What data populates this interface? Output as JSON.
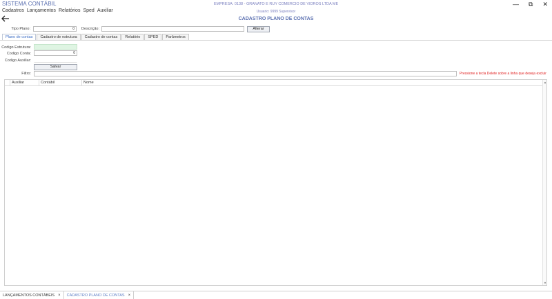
{
  "app": {
    "title": "SISTEMA CONTÁBIL",
    "company": "EMPRESA: 0138 - GRANATO E RUY COMERCIO DE VIDROS LTDA ME",
    "user": "Usuario: 9999 Supervisor",
    "screen_title": "CADASTRO PLANO DE CONTAS"
  },
  "menu": [
    "Cadastros",
    "Lançamentos",
    "Relatórios",
    "Sped",
    "Auxiliar"
  ],
  "window_controls": {
    "minimize": "—",
    "restore": "⧉",
    "close": "✕"
  },
  "form_top": {
    "tipo_plano_label": "Tipo Plano:",
    "tipo_plano_value": "0",
    "descricao_label": "Descrição:",
    "descricao_value": "",
    "alterar_label": "Alterar"
  },
  "tabs": [
    "Plano de contas",
    "Cadastro de estrutura",
    "Cadastro de contas",
    "Relatório",
    "SPED",
    "Parâmetros"
  ],
  "form": {
    "codigo_estrutura_label": "Codigo Estrutura:",
    "codigo_estrutura_value": "",
    "codigo_conta_label": "Codigo Conta:",
    "codigo_conta_value": "0",
    "codigo_auxiliar_label": "Codigo Auxiliar:",
    "codigo_auxiliar_value": "",
    "salvar_label": "Salvar",
    "filtro_label": "Filtro:",
    "filtro_value": "",
    "hint": "Pressione a tecla Delete sobre a linha que deseja excluir"
  },
  "grid": {
    "columns": [
      "Auxiliar",
      "Contábil",
      "Nome"
    ],
    "rows": []
  },
  "taskbar": [
    {
      "label": "LANÇAMENTOS CONTÁBEIS",
      "close": "×"
    },
    {
      "label": "CADASTRO PLANO DE CONTAS",
      "close": "×"
    }
  ],
  "colors": {
    "accent": "#5a6fb0",
    "active_tab": "#3b6cc4",
    "hint": "#e02020",
    "green_field": "#dff5e3"
  }
}
